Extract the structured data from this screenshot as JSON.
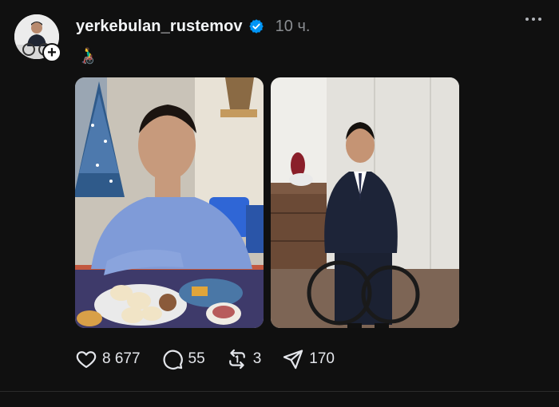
{
  "post": {
    "username": "yerkebulan_rustemov",
    "time": "10 ч.",
    "caption": "👨‍🦽",
    "verified": true,
    "icons": {
      "avatar": "profile-photo",
      "follow": "plus-icon",
      "verified": "verified-badge-icon",
      "more": "more-options-icon"
    },
    "media": [
      {
        "name": "photo-restaurant"
      },
      {
        "name": "photo-wheelchair-suit"
      }
    ],
    "actions": {
      "likes": "8 677",
      "replies": "55",
      "reposts": "3",
      "shares": "170"
    },
    "colors": {
      "background": "#101010",
      "text": "#f3f5f7",
      "muted": "#8a8d91",
      "verified": "#0095f6"
    }
  }
}
